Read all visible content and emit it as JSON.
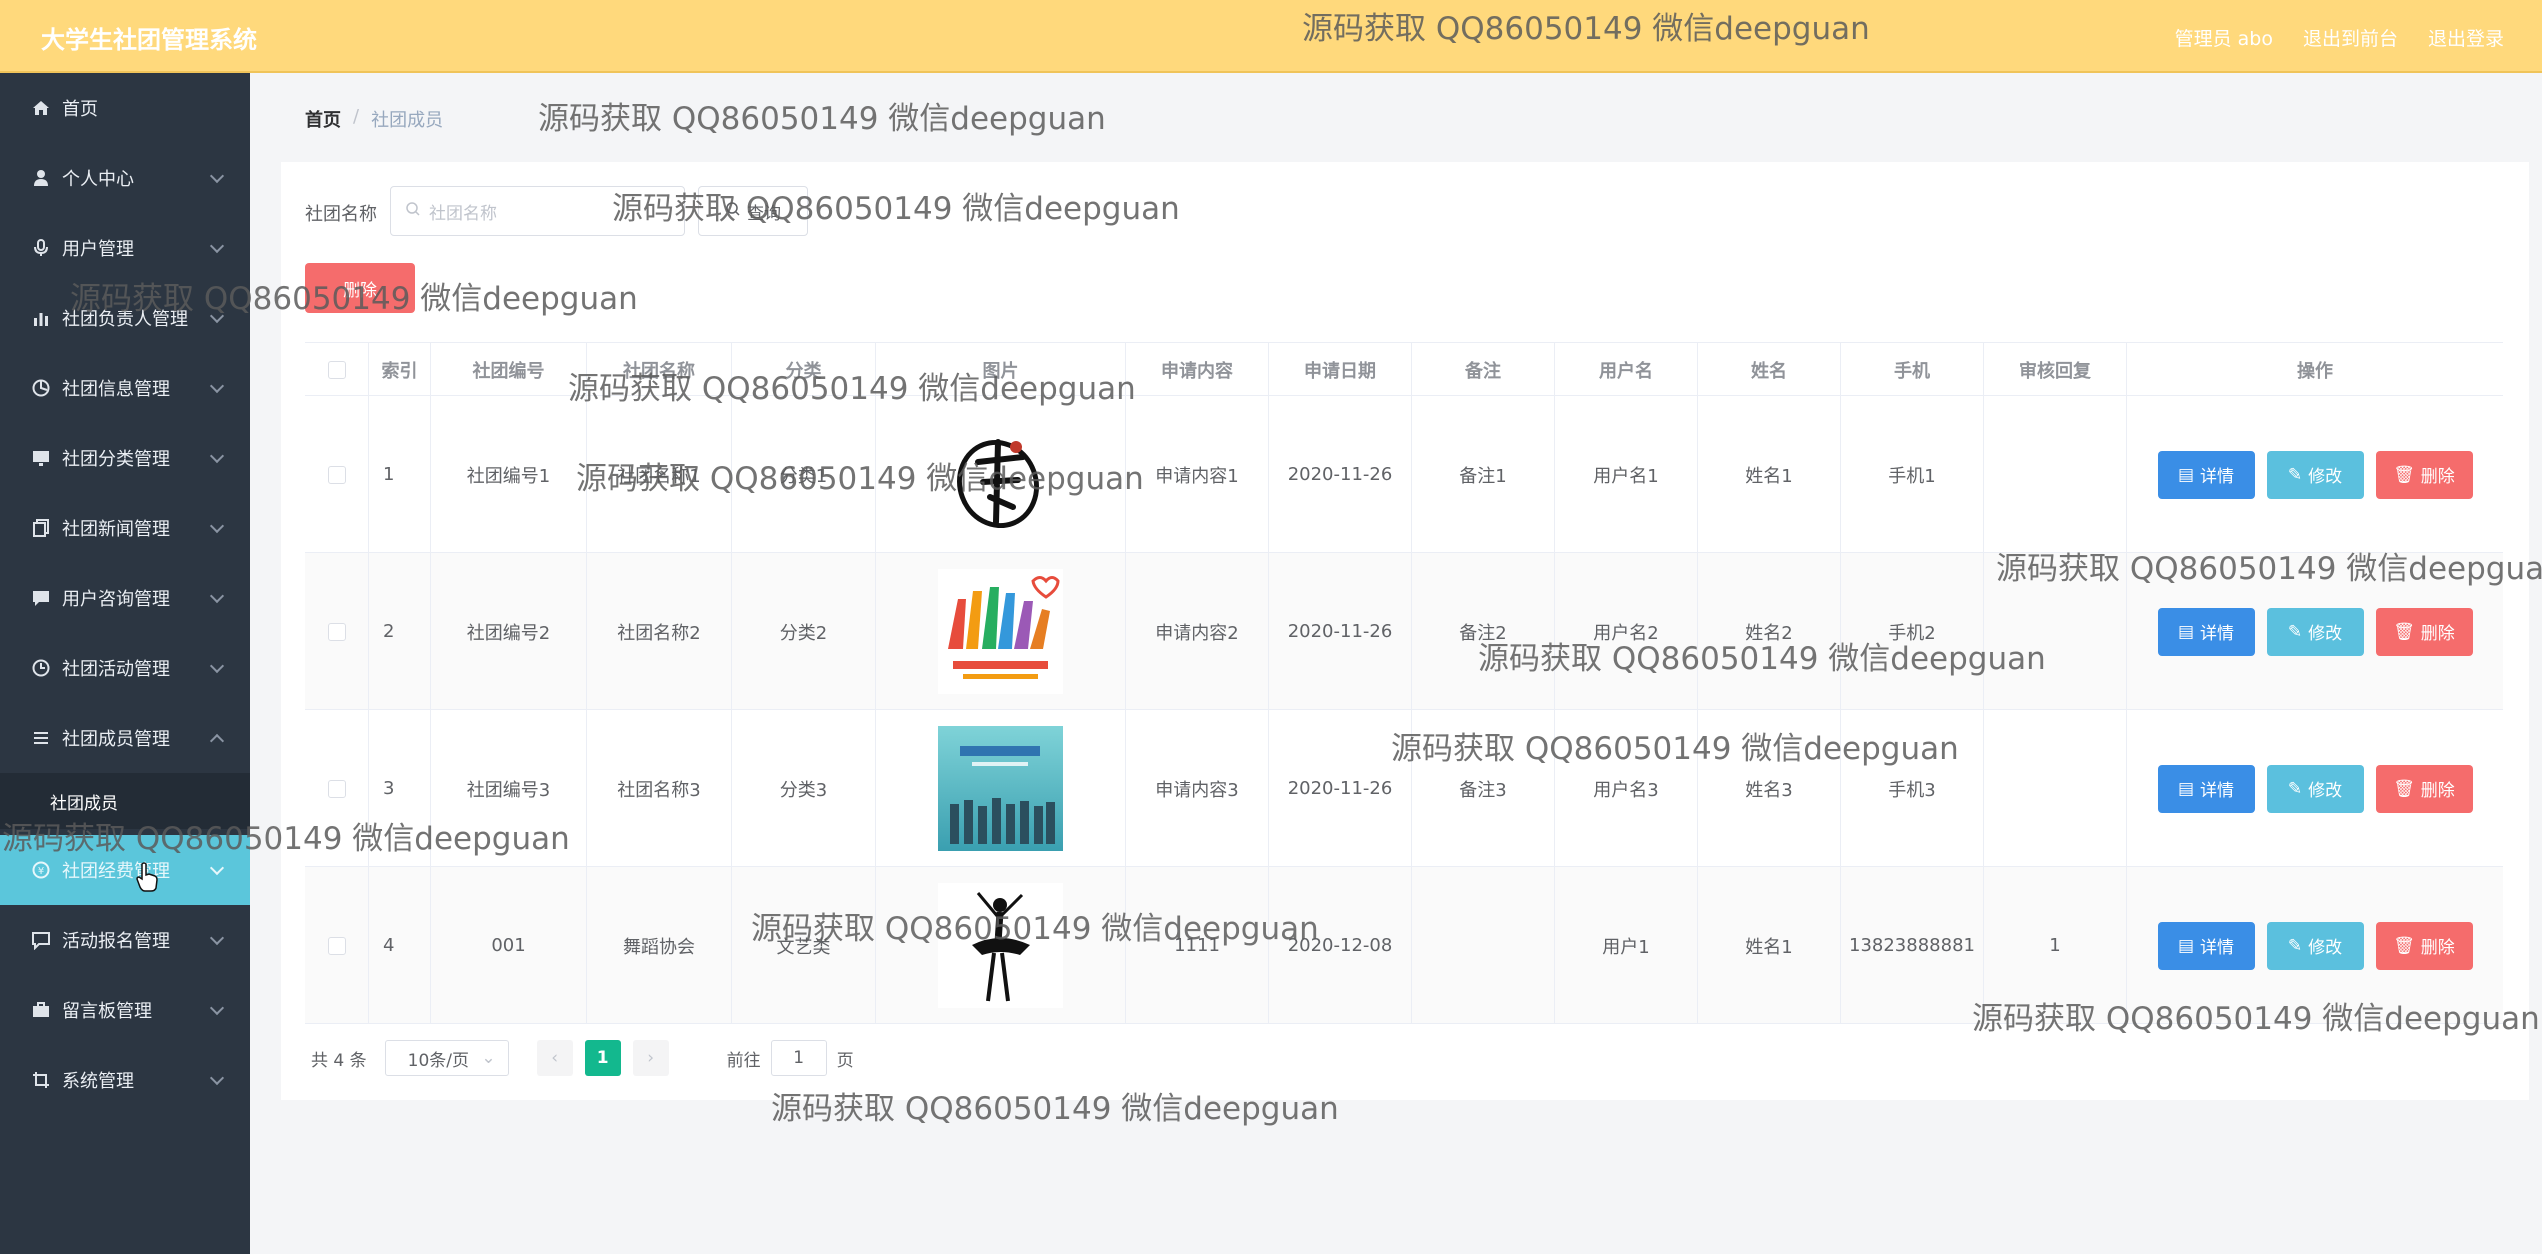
{
  "header": {
    "app_title": "大学生社团管理系统",
    "links": [
      "管理员 abo",
      "退出到前台",
      "退出登录"
    ]
  },
  "sidebar": {
    "items": [
      {
        "label": "首页",
        "icon": "home-icon"
      },
      {
        "label": "个人中心",
        "icon": "user-icon"
      },
      {
        "label": "用户管理",
        "icon": "mic-icon"
      },
      {
        "label": "社团负责人管理",
        "icon": "bar-chart-icon"
      },
      {
        "label": "社团信息管理",
        "icon": "circle-icon"
      },
      {
        "label": "社团分类管理",
        "icon": "monitor-icon"
      },
      {
        "label": "社团新闻管理",
        "icon": "copy-icon"
      },
      {
        "label": "用户咨询管理",
        "icon": "chat-icon"
      },
      {
        "label": "社团活动管理",
        "icon": "clock-icon"
      },
      {
        "label": "社团成员管理",
        "icon": "list-icon"
      },
      {
        "label": "社团经费管理",
        "icon": "coin-icon"
      },
      {
        "label": "活动报名管理",
        "icon": "chat-outline-icon"
      },
      {
        "label": "留言板管理",
        "icon": "briefcase-icon"
      },
      {
        "label": "系统管理",
        "icon": "crop-icon"
      }
    ],
    "subitem": "社团成员"
  },
  "breadcrumb": {
    "home": "首页",
    "sep": "/",
    "current": "社团成员"
  },
  "search": {
    "label": "社团名称",
    "placeholder": "社团名称",
    "query_button": "查询",
    "delete_button": "删除"
  },
  "table": {
    "headers": [
      "索引",
      "社团编号",
      "社团名称",
      "分类",
      "图片",
      "申请内容",
      "申请日期",
      "备注",
      "用户名",
      "姓名",
      "手机",
      "审核回复",
      "操作"
    ],
    "rows": [
      {
        "index": "1",
        "code": "社团编号1",
        "name": "社团名称1",
        "category": "分类1",
        "content": "申请内容1",
        "date": "2020-11-26",
        "remark": "备注1",
        "username": "用户名1",
        "realname": "姓名1",
        "phone": "手机1",
        "reply": ""
      },
      {
        "index": "2",
        "code": "社团编号2",
        "name": "社团名称2",
        "category": "分类2",
        "content": "申请内容2",
        "date": "2020-11-26",
        "remark": "备注2",
        "username": "用户名2",
        "realname": "姓名2",
        "phone": "手机2",
        "reply": ""
      },
      {
        "index": "3",
        "code": "社团编号3",
        "name": "社团名称3",
        "category": "分类3",
        "content": "申请内容3",
        "date": "2020-11-26",
        "remark": "备注3",
        "username": "用户名3",
        "realname": "姓名3",
        "phone": "手机3",
        "reply": ""
      },
      {
        "index": "4",
        "code": "001",
        "name": "舞蹈协会",
        "category": "文艺类",
        "content": "1111",
        "date": "2020-12-08",
        "remark": "",
        "username": "用户1",
        "realname": "姓名1",
        "phone": "13823888881",
        "reply": "1"
      }
    ],
    "actions": {
      "detail": "详情",
      "edit": "修改",
      "delete": "删除"
    }
  },
  "pagination": {
    "total": "共 4 条",
    "page_size": "10条/页",
    "current_page": "1",
    "goto_label": "前往",
    "goto_value": "1",
    "goto_unit": "页"
  },
  "watermark": "源码获取 QQ86050149 微信deepguan",
  "colors": {
    "header_bg": "#ffd97c",
    "sidebar_bg": "#2c3642",
    "active_item": "#5bc6db",
    "detail_btn": "#3a8ee6",
    "edit_btn": "#5bc0de",
    "delete_btn": "#f56c6c",
    "page_active": "#13b88e"
  }
}
